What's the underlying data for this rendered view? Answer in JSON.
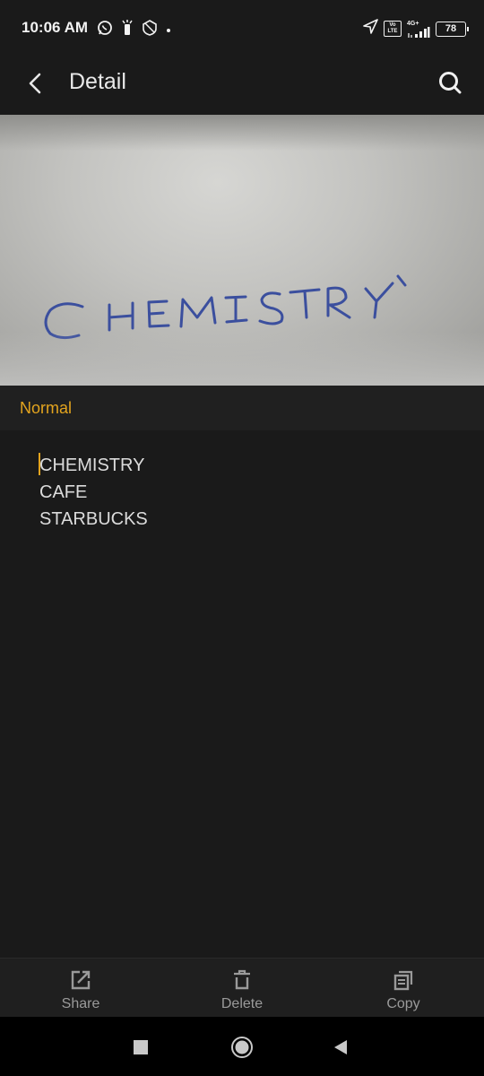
{
  "status_bar": {
    "time": "10:06 AM",
    "left_icons": [
      "whatsapp-icon",
      "flashlight-icon",
      "vpn-shield-icon",
      "dot-icon"
    ],
    "right_icons": [
      "location-arrow-icon",
      "volte-icon",
      "signal-4g-icon",
      "battery-icon"
    ],
    "volte_label": "Vo LTE",
    "network_label": "4G+",
    "battery_level": "78"
  },
  "app_bar": {
    "title": "Detail"
  },
  "photo": {
    "handwritten_text": "CHEMISTRY",
    "ink_color": "#3b4f9e"
  },
  "tab": {
    "label": "Normal",
    "color": "#e3a41e"
  },
  "recognized_text": {
    "lines": [
      "CHEMISTRY",
      "CAFE",
      "STARBUCKS"
    ]
  },
  "toolbar": {
    "share_label": "Share",
    "delete_label": "Delete",
    "copy_label": "Copy"
  },
  "nav": {
    "icons": [
      "recents-square-icon",
      "home-circle-icon",
      "back-triangle-icon"
    ]
  }
}
